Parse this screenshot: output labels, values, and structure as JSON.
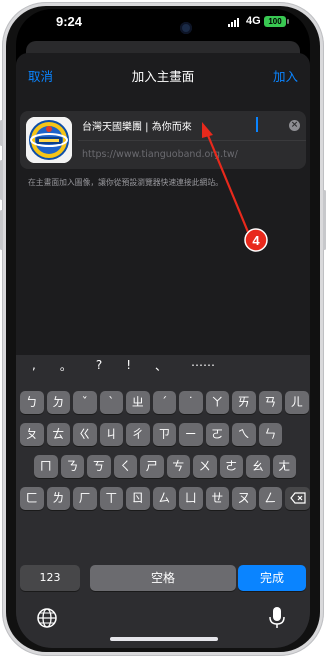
{
  "status_bar": {
    "time": "9:24",
    "network": "4G",
    "battery": "100"
  },
  "sheet": {
    "cancel_label": "取消",
    "title": "加入主畫面",
    "add_label": "加入",
    "app_name": "台灣天國樂團 | 為你而來",
    "url": "https://www.tianguoband.org.tw/",
    "hint": "在主畫面加入圖像，讓你從預設瀏覽器快速連接此網站。"
  },
  "annotation": {
    "step_number": "4"
  },
  "keyboard": {
    "suggestions": [
      ",",
      "。",
      "?",
      "!",
      "、",
      "⋯⋯"
    ],
    "row1": [
      "ㄅ",
      "ㄉ",
      "ˇ",
      "ˋ",
      "ㄓ",
      "ˊ",
      "˙",
      "ㄚ",
      "ㄞ",
      "ㄢ",
      "ㄦ"
    ],
    "row2": [
      "ㄆ",
      "ㄊ",
      "ㄍ",
      "ㄐ",
      "ㄔ",
      "ㄗ",
      "ㄧ",
      "ㄛ",
      "ㄟ",
      "ㄣ"
    ],
    "row3": [
      "ㄇ",
      "ㄋ",
      "ㄎ",
      "ㄑ",
      "ㄕ",
      "ㄘ",
      "ㄨ",
      "ㄜ",
      "ㄠ",
      "ㄤ"
    ],
    "row4": [
      "ㄈ",
      "ㄌ",
      "ㄏ",
      "ㄒ",
      "ㄖ",
      "ㄙ",
      "ㄩ",
      "ㄝ",
      "ㄡ",
      "ㄥ"
    ],
    "numbers_label": "123",
    "space_label": "空格",
    "done_label": "完成"
  },
  "colors": {
    "accent": "#0a84ff",
    "annotation_red": "#e8291c",
    "battery_green": "#39c852"
  }
}
